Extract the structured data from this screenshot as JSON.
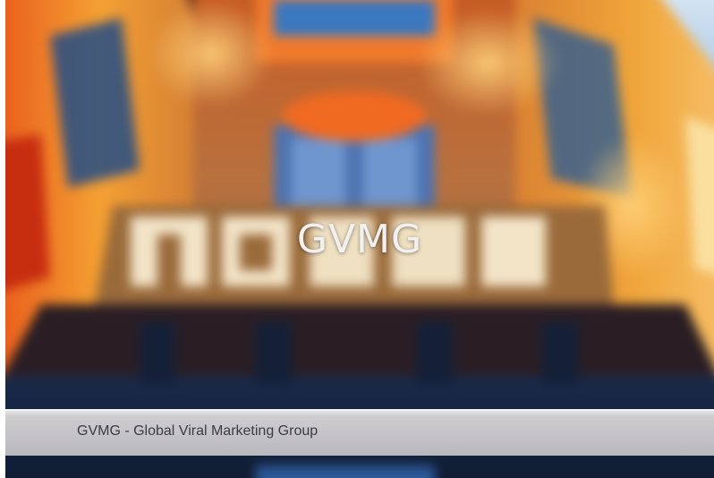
{
  "hero": {
    "title": "GVMG"
  },
  "caption": {
    "text": "GVMG - Global Viral Marketing Group"
  },
  "colors": {
    "glow_orange": "#f08a2a",
    "deep_red": "#c43a12",
    "window_blue": "#2b6fb2",
    "caption_bg": "#c2c1c5",
    "caption_text": "#3a3c48"
  }
}
